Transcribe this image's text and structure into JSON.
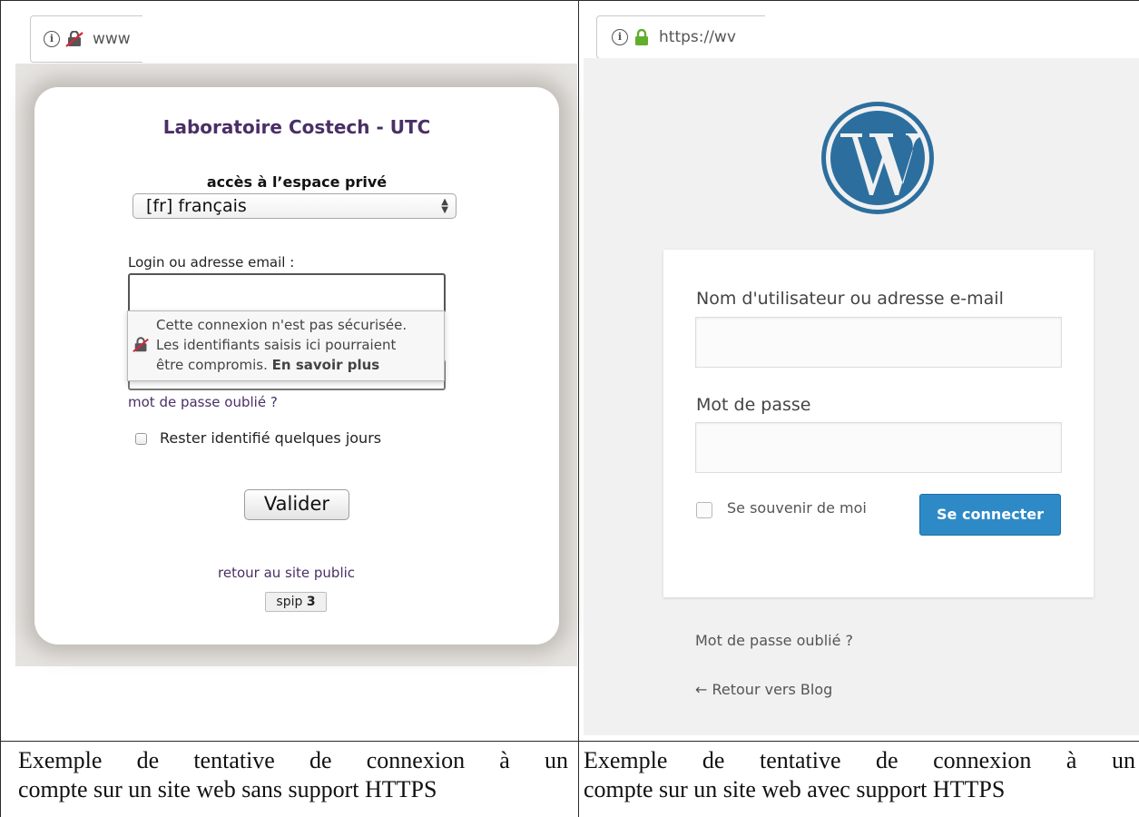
{
  "left_panel": {
    "urlbar_text": "www",
    "title": "Laboratoire Costech - UTC",
    "subtitle": "accès à l’espace privé",
    "language_select": "[fr] français",
    "login_label": "Login ou adresse email :",
    "warning": {
      "line1": "Cette connexion n'est pas sécurisée.",
      "line2": "Les identifiants saisis ici pourraient",
      "line3_prefix": "être compromis.",
      "line3_link": "En savoir plus"
    },
    "forgot_link": "mot de passe oublié ?",
    "remember_label": "Rester identifié quelques jours",
    "submit_label": "Valider",
    "back_link": "retour au site public",
    "badge": {
      "text": "spip",
      "number": "3"
    }
  },
  "right_panel": {
    "urlbar_text": "https://wv",
    "username_label": "Nom d'utilisateur ou adresse e-mail",
    "password_label": "Mot de passe",
    "remember_label": "Se souvenir de moi",
    "submit_label": "Se connecter",
    "forgot_link": "Mot de passe oublié ?",
    "back_link": "← Retour vers Blog"
  },
  "captions": {
    "left_line1": "Exemple de tentative de connexion à un",
    "left_line2": "compte sur un site web sans support HTTPS",
    "right_line1": "Exemple de tentative de connexion à un",
    "right_line2": "compte sur un site web avec support HTTPS"
  },
  "colors": {
    "spip_purple": "#4a2f66",
    "wp_blue": "#2e8ac7",
    "lock_green": "#5fae2e"
  }
}
